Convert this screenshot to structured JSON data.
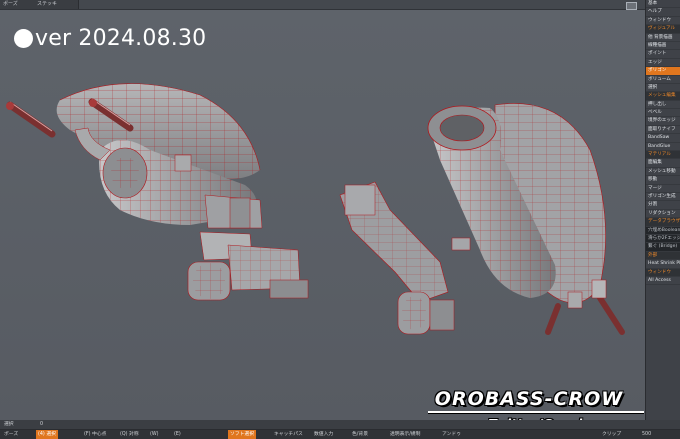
{
  "app": {
    "version_label": "ver 2024.08.30",
    "top_menus": [
      "ポーズ",
      "ステッキ"
    ]
  },
  "right_panel": {
    "items": [
      {
        "label": "基本",
        "state": "normal"
      },
      {
        "label": "ヘルプ",
        "state": "normal"
      },
      {
        "label": "ウィンドウ",
        "state": "normal"
      },
      {
        "label": "ヴィジュアル",
        "state": "header"
      },
      {
        "label": "他 背景描画",
        "state": "normal"
      },
      {
        "label": "線種描画",
        "state": "normal"
      },
      {
        "label": "ポイント",
        "state": "normal"
      },
      {
        "label": "エッジ",
        "state": "normal"
      },
      {
        "label": "ポリゴン",
        "state": "active"
      },
      {
        "label": "ボリューム",
        "state": "normal"
      },
      {
        "label": "選択",
        "state": "normal"
      },
      {
        "label": "メッシュ編集",
        "state": "header"
      },
      {
        "label": "押し出し",
        "state": "normal"
      },
      {
        "label": "べベル",
        "state": "normal"
      },
      {
        "label": "境界のエッジ",
        "state": "normal"
      },
      {
        "label": "面取りナイフ",
        "state": "normal"
      },
      {
        "label": "BandSaw",
        "state": "normal"
      },
      {
        "label": "BandGlue",
        "state": "normal"
      },
      {
        "label": "マテリアル",
        "state": "header"
      },
      {
        "label": "面編集",
        "state": "normal"
      },
      {
        "label": "メッシュ移動",
        "state": "normal"
      },
      {
        "label": "移動",
        "state": "normal"
      },
      {
        "label": "マージ",
        "state": "normal"
      },
      {
        "label": "ポリゴン生成",
        "state": "normal"
      },
      {
        "label": "分割",
        "state": "normal"
      },
      {
        "label": "リダクション",
        "state": "normal"
      },
      {
        "label": "データブラウザ",
        "state": "header"
      },
      {
        "label": "穴埋めBoolean",
        "state": "dark"
      },
      {
        "label": "滑らか2Fエッジ",
        "state": "dark"
      },
      {
        "label": "繋ぐ (Bridge)",
        "state": "dark"
      },
      {
        "label": "外部",
        "state": "header"
      },
      {
        "label": "Heat Shrink Plus",
        "state": "normal"
      },
      {
        "label": "ウィンドウ",
        "state": "header"
      },
      {
        "label": "All Access",
        "state": "normal"
      }
    ]
  },
  "bottom_bar": {
    "row1": [
      {
        "label": "選択",
        "state": "normal"
      },
      {
        "label": "0",
        "state": "normal"
      }
    ],
    "row2": [
      {
        "label": "ポーズ",
        "state": "normal"
      },
      {
        "label": "(4) 選択",
        "state": "active"
      },
      {
        "label": "(F) 中心点",
        "state": "normal"
      },
      {
        "label": "(Q) 対称",
        "state": "normal"
      },
      {
        "label": "(W)",
        "state": "normal"
      },
      {
        "label": "(E)",
        "state": "normal"
      },
      {
        "label": "ソフト選択",
        "state": "active"
      },
      {
        "label": "キャッチパス",
        "state": "normal"
      },
      {
        "label": "数値入力",
        "state": "normal"
      },
      {
        "label": "色/背景",
        "state": "normal"
      },
      {
        "label": "透明表示/規制",
        "state": "normal"
      },
      {
        "label": "アンドゥ",
        "state": "normal"
      },
      {
        "label": "クリップ",
        "state": "normal"
      },
      {
        "label": "500",
        "state": "normal"
      }
    ]
  },
  "watermark": {
    "brand": "OROBASS-CROW",
    "handle": "Twitter/@orobasscrow"
  },
  "colors": {
    "viewport_bg": "#5b5f66",
    "mesh_fill": "#9a9a9c",
    "mesh_edge": "#b0171c",
    "accent": "#e0761e"
  }
}
